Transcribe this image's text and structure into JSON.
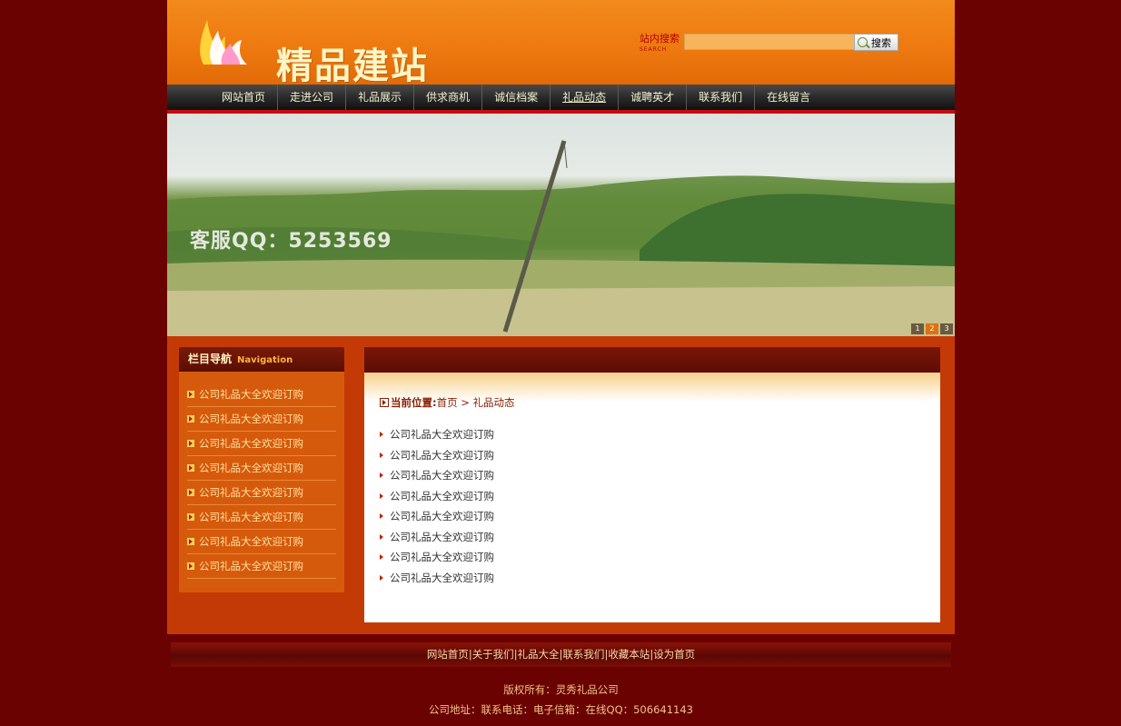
{
  "header": {
    "logo_text": "精品建站",
    "search_label": "站内搜索",
    "search_label_en": "SEARCH",
    "search_value": "",
    "search_button": "搜索"
  },
  "nav": {
    "items": [
      "网站首页",
      "走进公司",
      "礼品展示",
      "供求商机",
      "诚信档案",
      "礼品动态",
      "诚聘英才",
      "联系我们",
      "在线留言"
    ],
    "active": "礼品动态"
  },
  "banner": {
    "qq_text": "客服QQ：5253569",
    "dots": [
      "1",
      "2",
      "3"
    ],
    "active_dot": "2"
  },
  "sidebar": {
    "title": "栏目导航",
    "title_en": "Navigation",
    "items": [
      "公司礼品大全欢迎订购",
      "公司礼品大全欢迎订购",
      "公司礼品大全欢迎订购",
      "公司礼品大全欢迎订购",
      "公司礼品大全欢迎订购",
      "公司礼品大全欢迎订购",
      "公司礼品大全欢迎订购",
      "公司礼品大全欢迎订购"
    ]
  },
  "main": {
    "crumb_label": "当前位置:",
    "crumb_home": "首页",
    "crumb_sep": " > ",
    "crumb_current": "礼品动态",
    "items": [
      "公司礼品大全欢迎订购",
      "公司礼品大全欢迎订购",
      "公司礼品大全欢迎订购",
      "公司礼品大全欢迎订购",
      "公司礼品大全欢迎订购",
      "公司礼品大全欢迎订购",
      "公司礼品大全欢迎订购",
      "公司礼品大全欢迎订购"
    ]
  },
  "footer": {
    "links": [
      "网站首页",
      "关于我们",
      "礼品大全",
      "联系我们",
      "收藏本站",
      "设为首页"
    ],
    "sep": "|",
    "copyright": "版权所有：灵秀礼品公司",
    "address": "公司地址：联系电话：电子信箱：在线QQ：506641143"
  },
  "colors": {
    "page_bg": "#6b0202",
    "header_orange": "#ee7a10",
    "nav_dark": "#2a2a2a",
    "content_red": "#c43a06",
    "nav_accent": "#c80c0c"
  }
}
